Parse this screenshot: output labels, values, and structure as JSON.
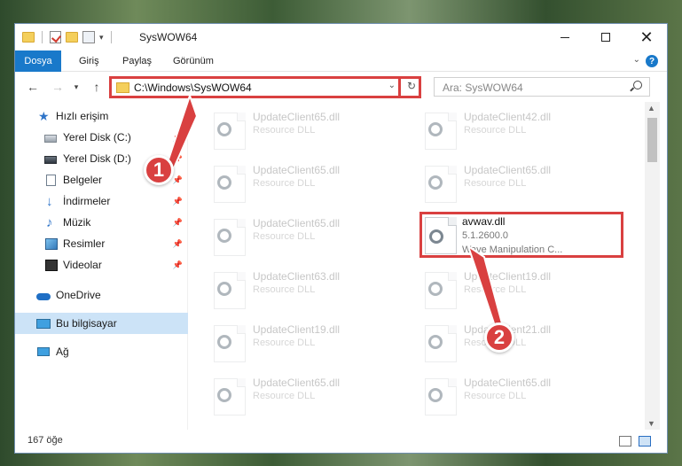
{
  "window": {
    "title": "SysWOW64"
  },
  "menu": {
    "file": "Dosya",
    "home": "Giriş",
    "share": "Paylaş",
    "view": "Görünüm",
    "help": "?"
  },
  "nav": {
    "address": "C:\\Windows\\SysWOW64",
    "search_placeholder": "Ara: SysWOW64"
  },
  "sidebar": {
    "items": [
      {
        "label": "Hızlı erişim",
        "icon": "star-icon"
      },
      {
        "label": "Yerel Disk (C:)",
        "icon": "drive-icon"
      },
      {
        "label": "Yerel Disk (D:)",
        "icon": "drive-icon"
      },
      {
        "label": "Belgeler",
        "icon": "document-icon"
      },
      {
        "label": "İndirmeler",
        "icon": "download-icon"
      },
      {
        "label": "Müzik",
        "icon": "music-icon"
      },
      {
        "label": "Resimler",
        "icon": "pictures-icon"
      },
      {
        "label": "Videolar",
        "icon": "video-icon"
      },
      {
        "label": "OneDrive",
        "icon": "cloud-icon"
      },
      {
        "label": "Bu bilgisayar",
        "icon": "computer-icon"
      },
      {
        "label": "Ağ",
        "icon": "network-icon"
      }
    ]
  },
  "files": [
    {
      "name": "UpdateClient65.dll",
      "type": "Resource DLL"
    },
    {
      "name": "UpdateClient42.dll",
      "type": "Resource DLL"
    },
    {
      "name": "UpdateClient65.dll",
      "type": "Resource DLL"
    },
    {
      "name": "UpdateClient65.dll",
      "type": "Resource DLL"
    },
    {
      "name": "UpdateClient65.dll",
      "type": "Resource DLL"
    },
    {
      "name": "avwav.dll",
      "version": "5.1.2600.0",
      "description": "Wave Manipulation C..."
    },
    {
      "name": "UpdateClient63.dll",
      "type": "Resource DLL"
    },
    {
      "name": "UpdateClient19.dll",
      "type": "Resource DLL"
    },
    {
      "name": "UpdateClient19.dll",
      "type": "Resource DLL"
    },
    {
      "name": "UpdateClient21.dll",
      "type": "Resource DLL"
    },
    {
      "name": "UpdateClient65.dll",
      "type": "Resource DLL"
    },
    {
      "name": "UpdateClient65.dll",
      "type": "Resource DLL"
    }
  ],
  "status": {
    "item_count": "167 öğe"
  },
  "markers": {
    "one": "1",
    "two": "2"
  },
  "colors": {
    "accent": "#1979ca",
    "highlight": "#d94040",
    "selected": "#cce3f7"
  }
}
